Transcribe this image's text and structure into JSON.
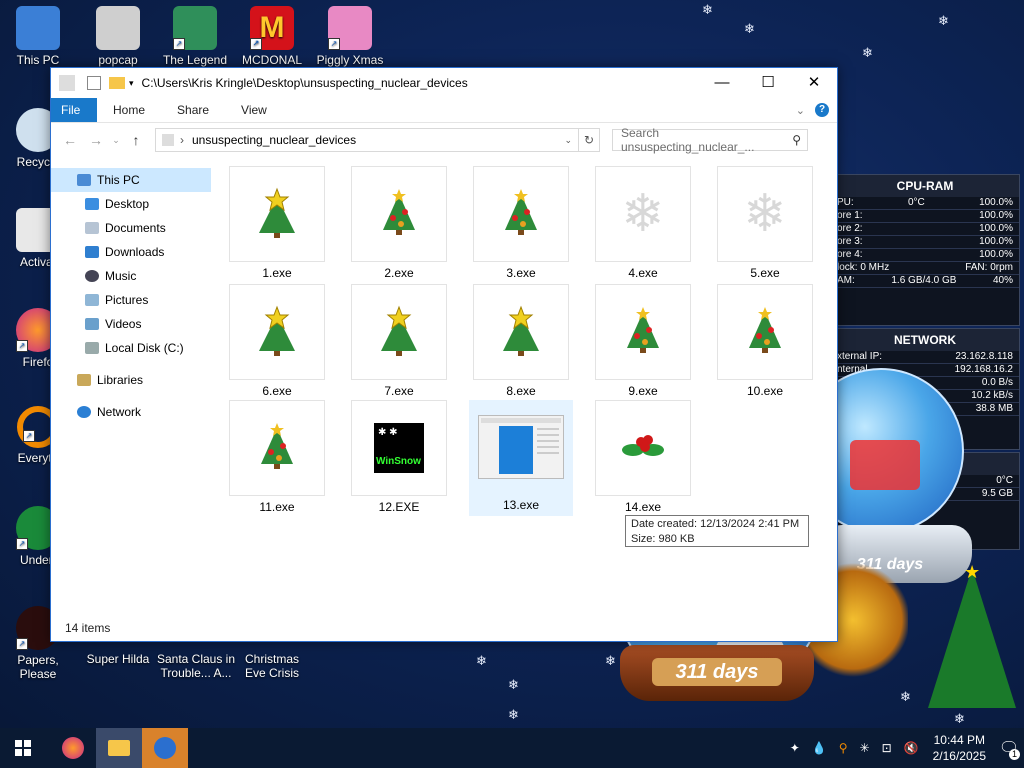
{
  "desktop": {
    "icons_col1": [
      {
        "label": "This PC"
      },
      {
        "label": "Recycle"
      },
      {
        "label": "Activat"
      },
      {
        "label": "Firefo"
      },
      {
        "label": "Everyth"
      },
      {
        "label": "Undert"
      },
      {
        "label": "Papers, Please"
      }
    ],
    "icons_top": [
      {
        "label": "popcap"
      },
      {
        "label": "The Legend"
      },
      {
        "label": "MCDONAL"
      },
      {
        "label": "Piggly Xmas"
      }
    ],
    "icons_bottom": [
      {
        "label": "Super Hilda"
      },
      {
        "label": "Santa Claus in Trouble... A..."
      },
      {
        "label": "Christmas Eve Crisis"
      }
    ]
  },
  "explorer": {
    "title": "C:\\Users\\Kris Kringle\\Desktop\\unsuspecting_nuclear_devices",
    "ribbon_tabs": [
      "File",
      "Home",
      "Share",
      "View"
    ],
    "path_current": "unsuspecting_nuclear_devices",
    "search_placeholder": "Search unsuspecting_nuclear_...",
    "nav": [
      {
        "label": "This PC"
      },
      {
        "label": "Desktop"
      },
      {
        "label": "Documents"
      },
      {
        "label": "Downloads"
      },
      {
        "label": "Music"
      },
      {
        "label": "Pictures"
      },
      {
        "label": "Videos"
      },
      {
        "label": "Local Disk (C:)"
      },
      {
        "label": "Libraries"
      },
      {
        "label": "Network"
      }
    ],
    "files": [
      {
        "name": "1.exe",
        "icon": "star-tree-icon"
      },
      {
        "name": "2.exe",
        "icon": "ornament-tree-icon"
      },
      {
        "name": "3.exe",
        "icon": "ornament-tree-icon"
      },
      {
        "name": "4.exe",
        "icon": "snowflake-icon"
      },
      {
        "name": "5.exe",
        "icon": "snowflake-icon"
      },
      {
        "name": "6.exe",
        "icon": "star-tree-icon"
      },
      {
        "name": "7.exe",
        "icon": "star-tree-icon"
      },
      {
        "name": "8.exe",
        "icon": "star-tree-icon"
      },
      {
        "name": "9.exe",
        "icon": "ornament-tree-icon"
      },
      {
        "name": "10.exe",
        "icon": "ornament-tree-icon"
      },
      {
        "name": "11.exe",
        "icon": "ornament-tree-icon"
      },
      {
        "name": "12.EXE",
        "icon": "winsnow-icon"
      },
      {
        "name": "13.exe",
        "icon": "window-icon"
      },
      {
        "name": "14.exe",
        "icon": "holly-icon"
      }
    ],
    "winsnow_text": "WinSnow",
    "status": "14 items",
    "tooltip": {
      "line1": "Date created: 12/13/2024 2:41 PM",
      "line2": "Size: 980 KB"
    }
  },
  "cpu_gadget": {
    "title": "CPU-RAM",
    "rows": [
      {
        "k": "PU:",
        "m": "0°C",
        "v": "100.0%"
      },
      {
        "k": "ore 1:",
        "m": "",
        "v": "100.0%"
      },
      {
        "k": "ore 2:",
        "m": "",
        "v": "100.0%"
      },
      {
        "k": "ore 3:",
        "m": "",
        "v": "100.0%"
      },
      {
        "k": "ore 4:",
        "m": "",
        "v": "100.0%"
      },
      {
        "k": "lock: 0 MHz",
        "m": "",
        "v": "FAN: 0rpm"
      },
      {
        "k": "AM:",
        "m": "1.6 GB/4.0 GB",
        "v": "40%"
      }
    ]
  },
  "net_gadget": {
    "title": "NETWORK",
    "rows": [
      {
        "k": "xternal IP:",
        "v": "23.162.8.118"
      },
      {
        "k": "nternal",
        "v": "192.168.16.2"
      },
      {
        "k": "",
        "v": "0.0 B/s"
      },
      {
        "k": "",
        "v": "10.2 kB/s"
      },
      {
        "k": "",
        "v": "38.8 MB"
      }
    ]
  },
  "disk_gadget": {
    "temp": "0°C",
    "size": "9.5 GB"
  },
  "globes": {
    "days_label": "311 days"
  },
  "taskbar": {
    "time": "10:44 PM",
    "date": "2/16/2025",
    "notif_count": "1"
  }
}
